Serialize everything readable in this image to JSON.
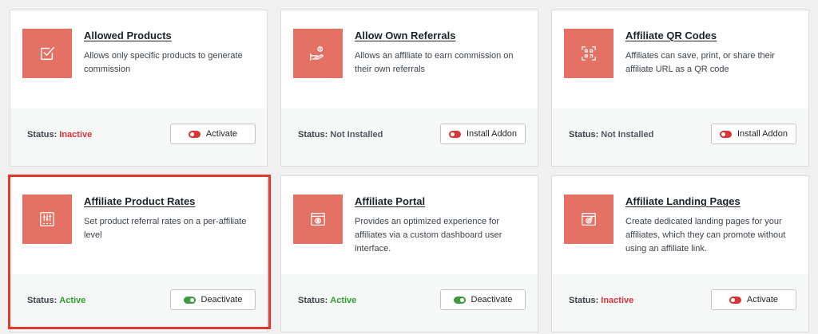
{
  "status_label": "Status:",
  "colors": {
    "thumb_bg": "#e57064",
    "inactive": "#d63638",
    "active": "#2e9e2e",
    "highlight": "#e3382b"
  },
  "addons": [
    {
      "title": "Allowed Products",
      "description": "Allows only specific products to generate commission",
      "icon": "checkbox-icon",
      "status": "Inactive",
      "button": "Activate",
      "toggle": "off"
    },
    {
      "title": "Allow Own Referrals",
      "description": "Allows an affiliate to earn commission on their own referrals",
      "icon": "hand-coins-icon",
      "status": "Not Installed",
      "button": "Install Addon",
      "toggle": "off"
    },
    {
      "title": "Affiliate QR Codes",
      "description": "Affiliates can save, print, or share their affiliate URL as a QR code",
      "icon": "qr-code-icon",
      "status": "Not Installed",
      "button": "Install Addon",
      "toggle": "off"
    },
    {
      "title": "Affiliate Product Rates",
      "description": "Set product referral rates on a per-affiliate level",
      "icon": "sliders-icon",
      "status": "Active",
      "button": "Deactivate",
      "toggle": "on"
    },
    {
      "title": "Affiliate Portal",
      "description": "Provides an optimized experience for affiliates via a custom dashboard user interface.",
      "icon": "browser-user-icon",
      "status": "Active",
      "button": "Deactivate",
      "toggle": "on"
    },
    {
      "title": "Affiliate Landing Pages",
      "description": "Create dedicated landing pages for your affiliates, which they can promote without using an affiliate link.",
      "icon": "browser-target-icon",
      "status": "Inactive",
      "button": "Activate",
      "toggle": "off"
    }
  ]
}
